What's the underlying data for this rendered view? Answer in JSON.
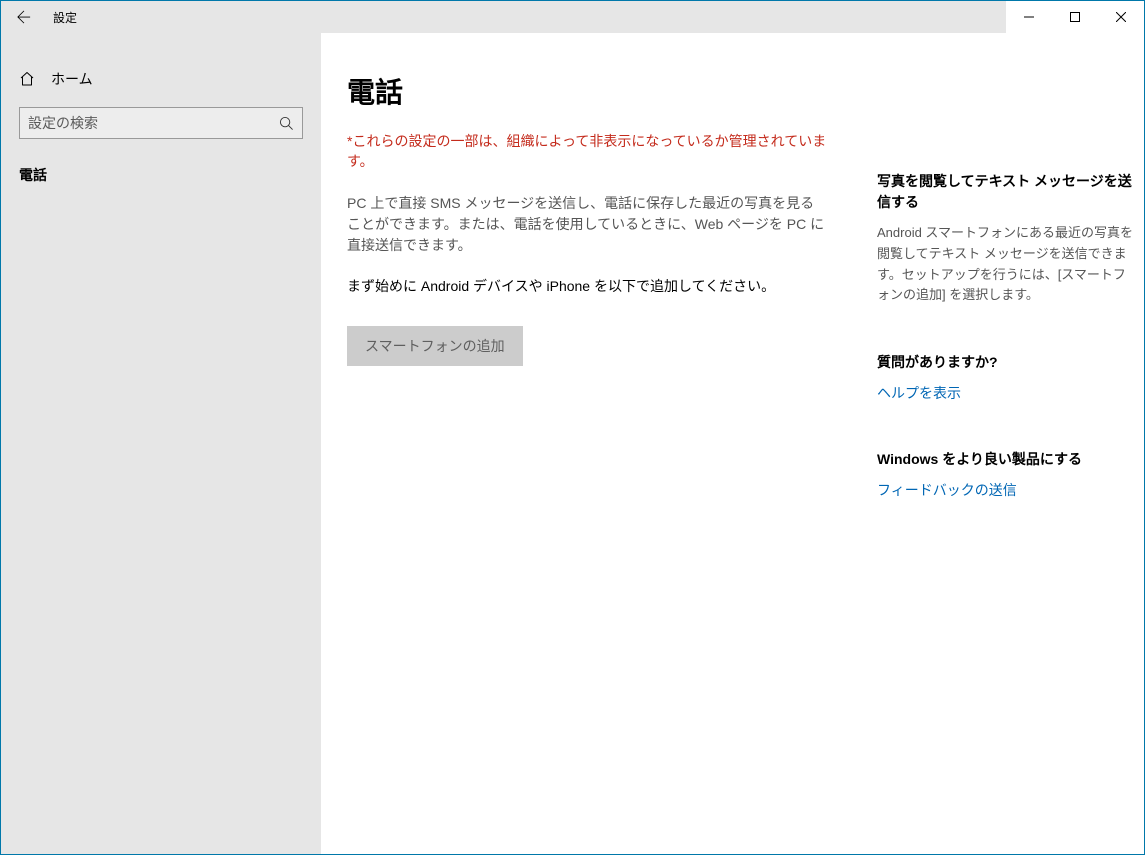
{
  "window": {
    "title": "設定"
  },
  "sidebar": {
    "home_label": "ホーム",
    "search_placeholder": "設定の検索",
    "nav": {
      "phone": "電話"
    }
  },
  "main": {
    "title": "電話",
    "policy_note": "*これらの設定の一部は、組織によって非表示になっているか管理されています。",
    "description": "PC 上で直接 SMS メッセージを送信し、電話に保存した最近の写真を見ることができます。または、電話を使用しているときに、Web ページを PC に直接送信できます。",
    "instruction": "まず始めに Android デバイスや iPhone を以下で追加してください。",
    "add_button": "スマートフォンの追加"
  },
  "aside": {
    "block1": {
      "heading": "写真を閲覧してテキスト メッセージを送信する",
      "text": "Android スマートフォンにある最近の写真を閲覧してテキスト メッセージを送信できます。セットアップを行うには、[スマートフォンの追加] を選択します。"
    },
    "block2": {
      "heading": "質問がありますか?",
      "link": "ヘルプを表示"
    },
    "block3": {
      "heading": "Windows をより良い製品にする",
      "link": "フィードバックの送信"
    }
  }
}
